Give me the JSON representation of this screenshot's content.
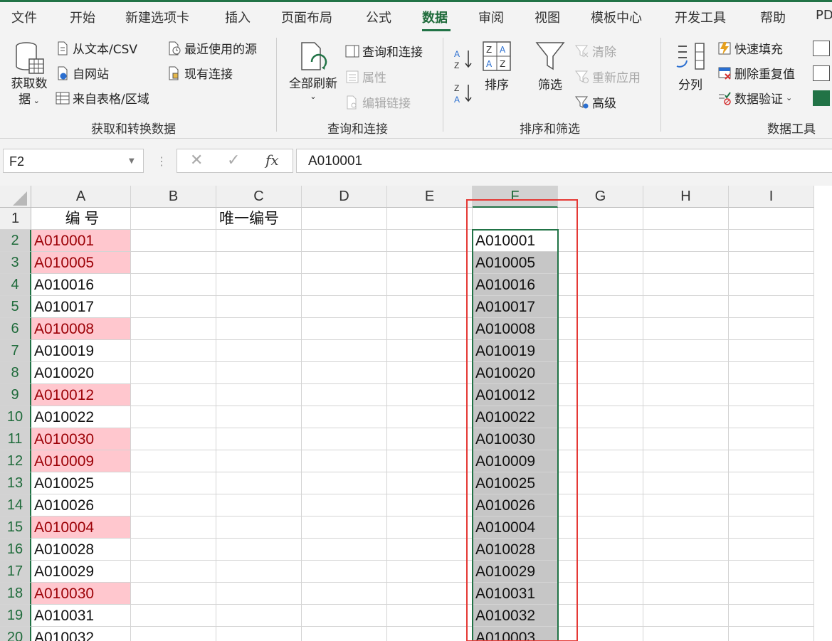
{
  "tabs": [
    "文件",
    "开始",
    "新建选项卡",
    "插入",
    "页面布局",
    "公式",
    "数据",
    "审阅",
    "视图",
    "模板中心",
    "开发工具",
    "帮助",
    "PD"
  ],
  "active_tab": "数据",
  "ribbon": {
    "get_data": "获取数",
    "get_data2": "据",
    "from_text_csv": "从文本/CSV",
    "from_web": "自网站",
    "from_table": "来自表格/区域",
    "recent_sources": "最近使用的源",
    "existing_conn": "现有连接",
    "group_get": "获取和转换数据",
    "refresh_all": "全部刷新",
    "queries_conn": "查询和连接",
    "properties": "属性",
    "edit_links": "编辑链接",
    "group_query": "查询和连接",
    "sort": "排序",
    "filter": "筛选",
    "clear": "清除",
    "reapply": "重新应用",
    "advanced": "高级",
    "group_sort": "排序和筛选",
    "text_to_columns": "分列",
    "flash_fill": "快速填充",
    "remove_dup": "删除重复值",
    "data_validation": "数据验证",
    "group_tools": "数据工具"
  },
  "formula_bar": {
    "name_box": "F2",
    "formula": "A010001"
  },
  "columns": [
    "A",
    "B",
    "C",
    "D",
    "E",
    "F",
    "G",
    "H",
    "I"
  ],
  "selected_column": "F",
  "rows": [
    "1",
    "2",
    "3",
    "4",
    "5",
    "6",
    "7",
    "8",
    "9",
    "10",
    "11",
    "12",
    "13",
    "14",
    "15",
    "16",
    "17",
    "18",
    "19",
    "20"
  ],
  "headers": {
    "a1": "编  号",
    "c1": "唯一编号"
  },
  "col_a": [
    {
      "v": "A010001",
      "dup": true
    },
    {
      "v": "A010005",
      "dup": true
    },
    {
      "v": "A010016",
      "dup": false
    },
    {
      "v": "A010017",
      "dup": false
    },
    {
      "v": "A010008",
      "dup": true
    },
    {
      "v": "A010019",
      "dup": false
    },
    {
      "v": "A010020",
      "dup": false
    },
    {
      "v": "A010012",
      "dup": true
    },
    {
      "v": "A010022",
      "dup": false
    },
    {
      "v": "A010030",
      "dup": true
    },
    {
      "v": "A010009",
      "dup": true
    },
    {
      "v": "A010025",
      "dup": false
    },
    {
      "v": "A010026",
      "dup": false
    },
    {
      "v": "A010004",
      "dup": true
    },
    {
      "v": "A010028",
      "dup": false
    },
    {
      "v": "A010029",
      "dup": false
    },
    {
      "v": "A010030",
      "dup": true
    },
    {
      "v": "A010031",
      "dup": false
    },
    {
      "v": "A010032",
      "dup": false
    }
  ],
  "col_f": [
    "A010001",
    "A010005",
    "A010016",
    "A010017",
    "A010008",
    "A010019",
    "A010020",
    "A010012",
    "A010022",
    "A010030",
    "A010009",
    "A010025",
    "A010026",
    "A010004",
    "A010028",
    "A010029",
    "A010031",
    "A010032",
    "A010003"
  ],
  "colors": {
    "accent": "#217346",
    "dup_bg": "#ffc7ce",
    "dup_text": "#9c0006",
    "highlight_box": "#e53935"
  }
}
